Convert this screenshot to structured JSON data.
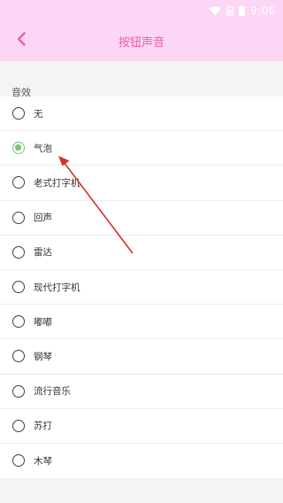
{
  "statusbar": {
    "time": "9:06",
    "icons": [
      "wifi-icon",
      "sim-icon",
      "battery-icon"
    ]
  },
  "appbar": {
    "title": "按钮声音",
    "back_icon": "chevron-left-icon"
  },
  "section": {
    "header": "音效"
  },
  "options": [
    {
      "label": "无",
      "checked": false
    },
    {
      "label": "气泡",
      "checked": true
    },
    {
      "label": "老式打字机",
      "checked": false
    },
    {
      "label": "回声",
      "checked": false
    },
    {
      "label": "雷达",
      "checked": false
    },
    {
      "label": "现代打字机",
      "checked": false
    },
    {
      "label": "嘟嘟",
      "checked": false
    },
    {
      "label": "钢琴",
      "checked": false
    },
    {
      "label": "流行音乐",
      "checked": false
    },
    {
      "label": "苏打",
      "checked": false
    },
    {
      "label": "木琴",
      "checked": false
    }
  ],
  "colors": {
    "appbar_bg": "#fcd6f5",
    "accent": "#ec5fa6",
    "radio_checked": "#7cc576",
    "annotation_arrow": "#d0342c"
  }
}
